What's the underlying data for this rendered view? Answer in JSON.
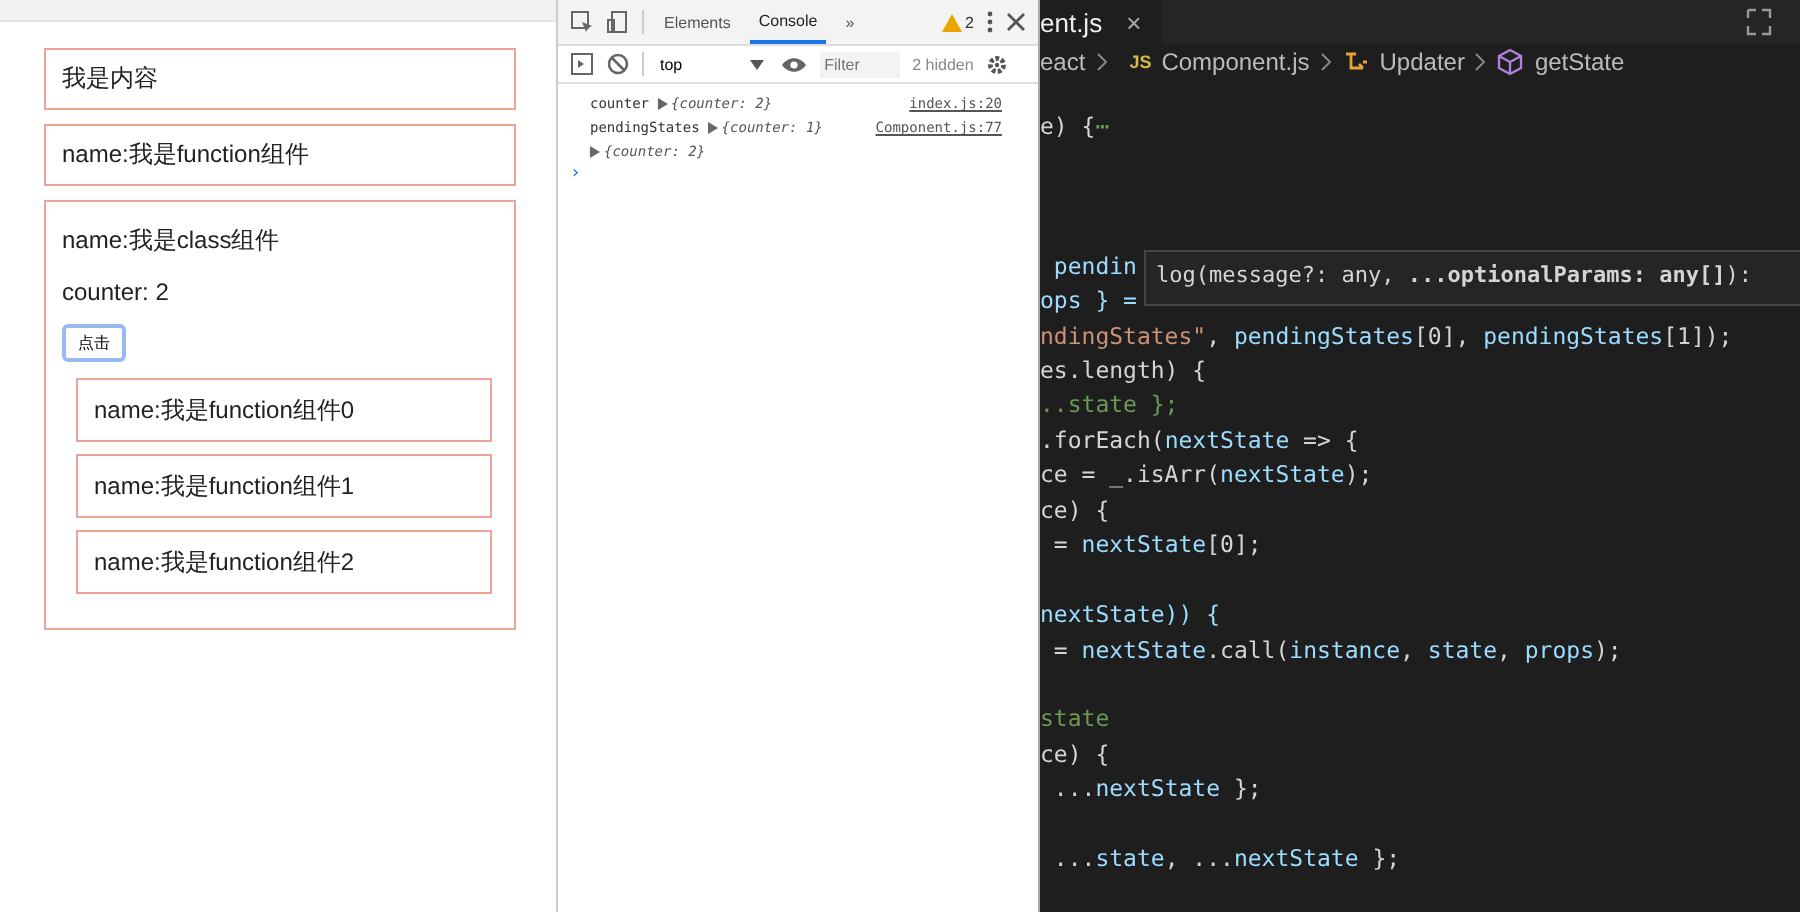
{
  "page": {
    "boxes": [
      {
        "text": "我是内容"
      },
      {
        "text": "name:我是function组件"
      }
    ],
    "class_box": {
      "name": "name:我是class组件",
      "counter": "counter: 2",
      "button": "点击",
      "children": [
        {
          "text": "name:我是function组件0"
        },
        {
          "text": "name:我是function组件1"
        },
        {
          "text": "name:我是function组件2"
        }
      ]
    }
  },
  "devtools": {
    "tabs": [
      {
        "label": "Elements",
        "selected": false
      },
      {
        "label": "Console",
        "selected": true
      }
    ],
    "more": "»",
    "warnings": "2",
    "context": "top",
    "filter": {
      "placeholder": "Filter"
    },
    "hidden": "2 hidden",
    "messages": [
      {
        "label": "counter",
        "object": "{counter: 2}",
        "source": "index.js:20"
      },
      {
        "label": "pendingStates",
        "object": "{counter: 1}",
        "source": "Component.js:77"
      },
      {
        "object": "{counter: 2}"
      }
    ],
    "prompt": "›"
  },
  "editor": {
    "tab": {
      "label": "ent.js",
      "close": "×"
    },
    "breadcrumb": [
      {
        "text": "eact",
        "kind": "folder"
      },
      {
        "text": "Component.js",
        "kind": "file"
      },
      {
        "text": "Updater",
        "kind": "class"
      },
      {
        "text": "getState",
        "kind": "method"
      }
    ],
    "file_badge": "JS",
    "folded_line": [
      {
        "text": "e) {",
        "kind": "plain"
      },
      {
        "text": "⋯",
        "kind": "comment"
      }
    ],
    "blocks": [
      [
        [
          {
            "text": " pendin",
            "kind": "name"
          }
        ],
        [
          {
            "text": "ops } =",
            "kind": "name"
          }
        ],
        [
          {
            "text": "ndingStates\"",
            "kind": "string"
          },
          {
            "text": ", ",
            "kind": "plain"
          },
          {
            "text": "pendingStates",
            "kind": "name"
          },
          {
            "text": "[0], ",
            "kind": "plain"
          },
          {
            "text": "pendingStates",
            "kind": "name"
          },
          {
            "text": "[1]);",
            "kind": "plain"
          }
        ],
        [
          {
            "text": "es.length) {",
            "kind": "plain"
          }
        ],
        [
          {
            "text": "..state };",
            "kind": "comment"
          }
        ],
        [
          {
            "text": ".forEach(",
            "kind": "plain"
          },
          {
            "text": "nextState",
            "kind": "name"
          },
          {
            "text": " => {",
            "kind": "plain"
          }
        ],
        [
          {
            "text": "ce = _.isArr(",
            "kind": "plain"
          },
          {
            "text": "nextState",
            "kind": "name"
          },
          {
            "text": ");",
            "kind": "plain"
          }
        ],
        [
          {
            "text": "ce) {",
            "kind": "plain"
          }
        ],
        [
          {
            "text": " = ",
            "kind": "plain"
          },
          {
            "text": "nextState",
            "kind": "name"
          },
          {
            "text": "[0];",
            "kind": "plain"
          }
        ]
      ],
      [
        [
          {
            "text": "nextState)) {",
            "kind": "name"
          }
        ],
        [
          {
            "text": " = ",
            "kind": "plain"
          },
          {
            "text": "nextState",
            "kind": "name"
          },
          {
            "text": ".call(",
            "kind": "plain"
          },
          {
            "text": "instance",
            "kind": "name"
          },
          {
            "text": ", ",
            "kind": "plain"
          },
          {
            "text": "state",
            "kind": "name"
          },
          {
            "text": ", ",
            "kind": "plain"
          },
          {
            "text": "props",
            "kind": "name"
          },
          {
            "text": ");",
            "kind": "plain"
          }
        ]
      ],
      [
        [
          {
            "text": "state",
            "kind": "comment"
          }
        ],
        [
          {
            "text": "ce) {",
            "kind": "plain"
          }
        ],
        [
          {
            "text": " ...",
            "kind": "plain"
          },
          {
            "text": "nextState",
            "kind": "name"
          },
          {
            "text": " };",
            "kind": "plain"
          }
        ]
      ],
      [
        [
          {
            "text": " ...",
            "kind": "plain"
          },
          {
            "text": "state",
            "kind": "name"
          },
          {
            "text": ", ...",
            "kind": "plain"
          },
          {
            "text": "nextState",
            "kind": "name"
          },
          {
            "text": " };",
            "kind": "plain"
          }
        ]
      ]
    ],
    "tooltip": "log(message?: any, **...optionalParams: any[]**):"
  }
}
